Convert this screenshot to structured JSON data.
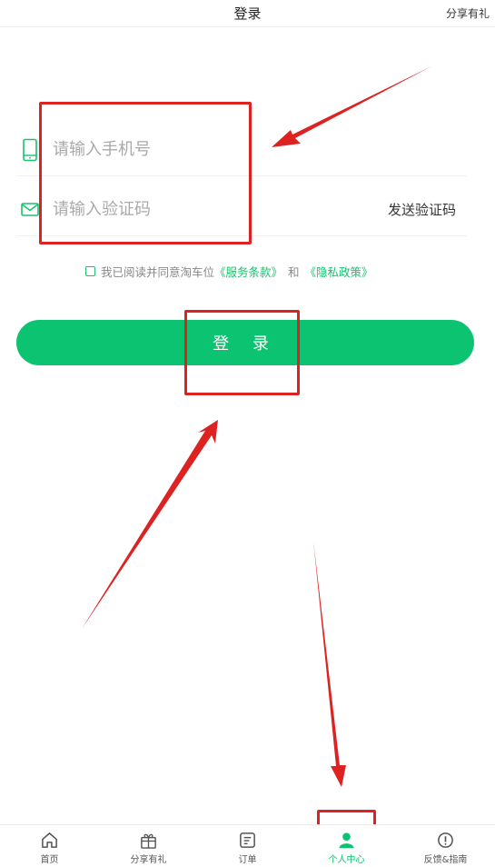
{
  "header": {
    "title": "登录",
    "share_label": "分享有礼"
  },
  "form": {
    "phone_placeholder": "请输入手机号",
    "code_placeholder": "请输入验证码",
    "send_code_label": "发送验证码"
  },
  "agreement": {
    "prefix": "我已阅读并同意淘车位",
    "terms_link": "《服务条款》",
    "and": "和",
    "privacy_link": "《隐私政策》"
  },
  "login_button": "登 录",
  "tabs": [
    {
      "label": "首页",
      "icon": "home-icon"
    },
    {
      "label": "分享有礼",
      "icon": "gift-icon"
    },
    {
      "label": "订单",
      "icon": "order-icon"
    },
    {
      "label": "个人中心",
      "icon": "person-icon",
      "active": true
    },
    {
      "label": "反馈&指南",
      "icon": "info-icon"
    }
  ],
  "colors": {
    "accent": "#0cc372",
    "annotation": "#dd2222"
  }
}
